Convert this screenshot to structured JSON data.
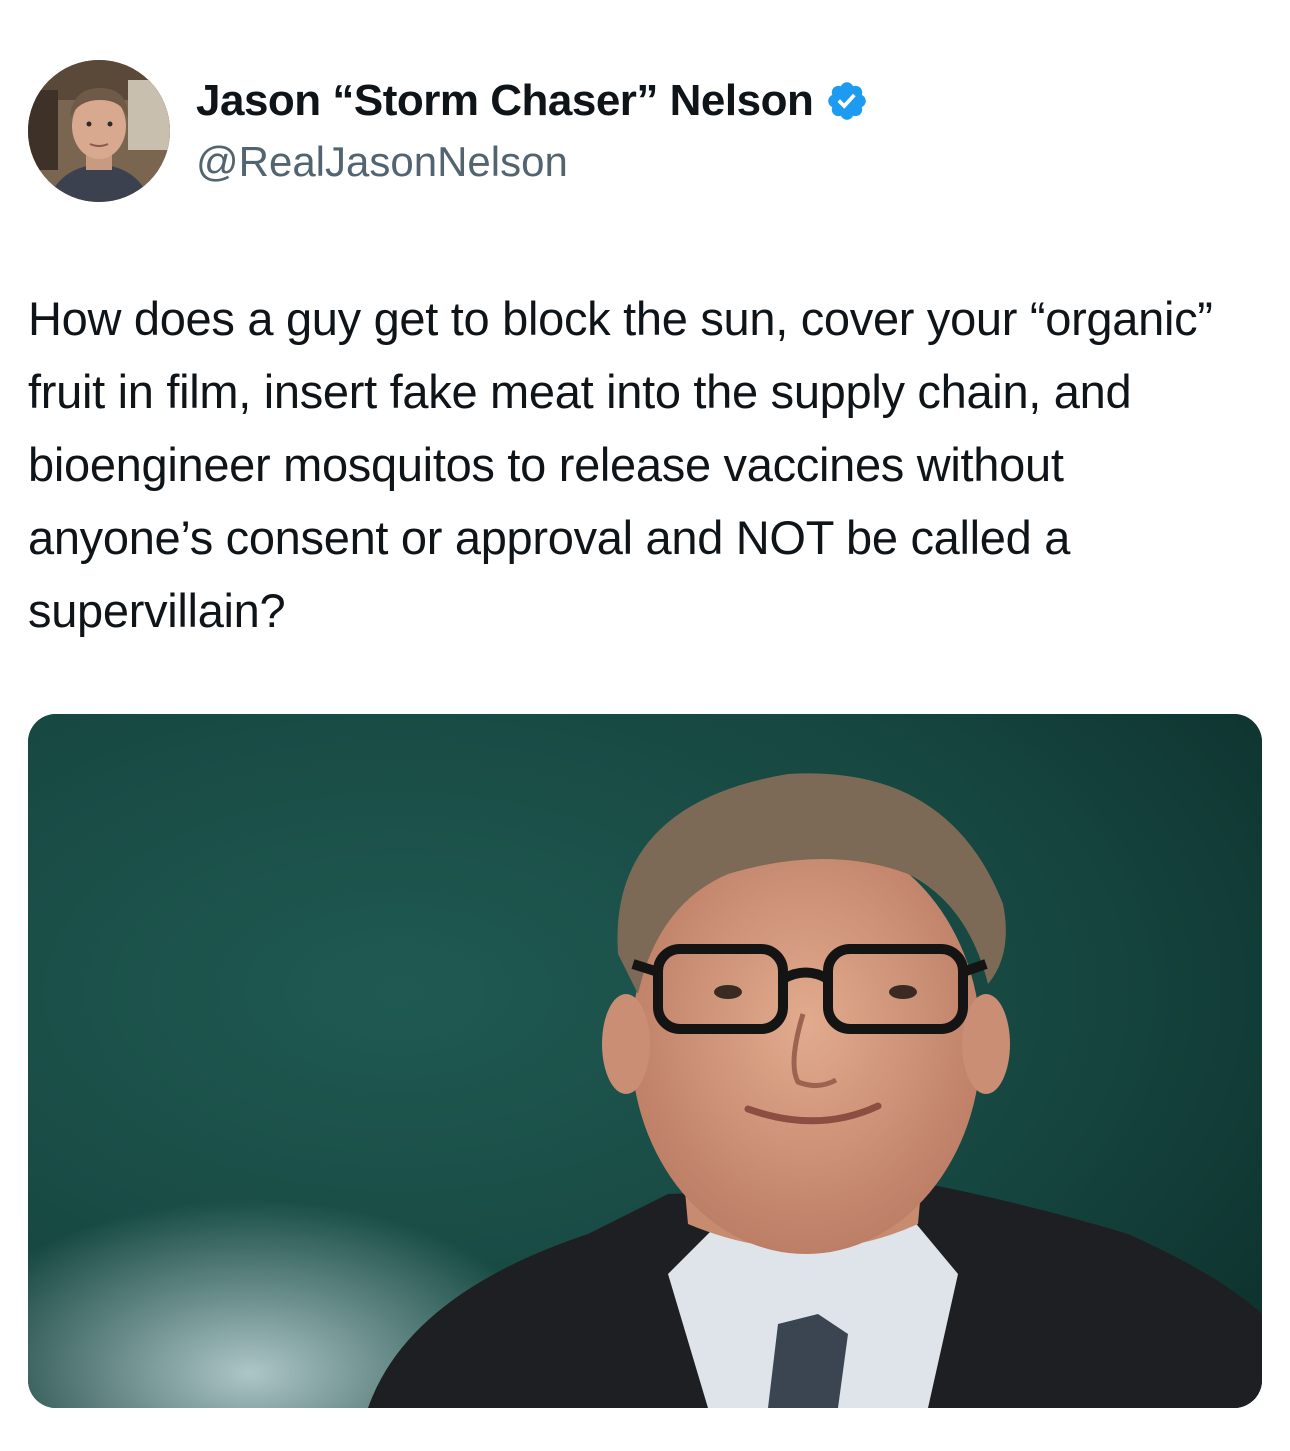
{
  "tweet": {
    "author": {
      "display_name": "Jason “Storm Chaser” Nelson",
      "handle": "@RealJasonNelson",
      "verified": true,
      "verified_color": "#1d9bf0",
      "avatar_icon": "profile-photo"
    },
    "text": "How does a guy get to block the sun, cover your “organic” fruit in film, insert fake meat into the supply chain, and bioengineer mosquitos to release vaccines without anyone’s consent or approval and NOT be called a supervillain?",
    "media": {
      "type": "photo",
      "icon": "attached-photo"
    }
  },
  "colors": {
    "text_primary": "#0f1419",
    "text_secondary": "#536471",
    "photo_background": "#1c4a45"
  }
}
